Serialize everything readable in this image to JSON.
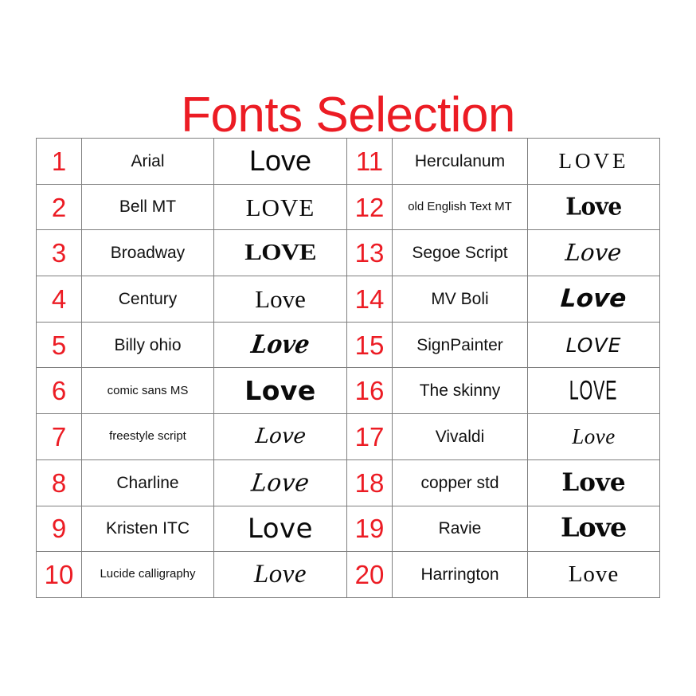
{
  "title": "Fonts Selection",
  "colors": {
    "title_red": "#ec1c24",
    "number_red": "#ec1c24",
    "border_gray": "#7f7f7f",
    "sample_black": "#0a0a0a",
    "background": "#ffffff"
  },
  "table": {
    "left_column": [
      {
        "number": "1",
        "font_name": "Arial",
        "sample": "Love",
        "name_size": "normal"
      },
      {
        "number": "2",
        "font_name": "Bell MT",
        "sample": "LOVE",
        "name_size": "normal"
      },
      {
        "number": "3",
        "font_name": "Broadway",
        "sample": "LOVE",
        "name_size": "normal"
      },
      {
        "number": "4",
        "font_name": "Century",
        "sample": "Love",
        "name_size": "normal"
      },
      {
        "number": "5",
        "font_name": "Billy ohio",
        "sample": "Love",
        "name_size": "normal"
      },
      {
        "number": "6",
        "font_name": "comic sans MS",
        "sample": "Love",
        "name_size": "small"
      },
      {
        "number": "7",
        "font_name": "freestyle script",
        "sample": "Love",
        "name_size": "small"
      },
      {
        "number": "8",
        "font_name": "Charline",
        "sample": "Love",
        "name_size": "normal"
      },
      {
        "number": "9",
        "font_name": "Kristen ITC",
        "sample": "Love",
        "name_size": "normal"
      },
      {
        "number": "10",
        "font_name": "Lucide calligraphy",
        "sample": "Love",
        "name_size": "small"
      }
    ],
    "right_column": [
      {
        "number": "11",
        "font_name": "Herculanum",
        "sample": "LOVE",
        "name_size": "normal"
      },
      {
        "number": "12",
        "font_name": "old English Text MT",
        "sample": "Love",
        "name_size": "small"
      },
      {
        "number": "13",
        "font_name": "Segoe Script",
        "sample": "Love",
        "name_size": "normal"
      },
      {
        "number": "14",
        "font_name": "MV Boli",
        "sample": "Love",
        "name_size": "normal"
      },
      {
        "number": "15",
        "font_name": "SignPainter",
        "sample": "LOVE",
        "name_size": "normal"
      },
      {
        "number": "16",
        "font_name": "The skinny",
        "sample": "LOVE",
        "name_size": "normal"
      },
      {
        "number": "17",
        "font_name": "Vivaldi",
        "sample": "Love",
        "name_size": "normal"
      },
      {
        "number": "18",
        "font_name": "copper std",
        "sample": "Love",
        "name_size": "normal"
      },
      {
        "number": "19",
        "font_name": "Ravie",
        "sample": "Love",
        "name_size": "normal"
      },
      {
        "number": "20",
        "font_name": "Harrington",
        "sample": "Love",
        "name_size": "normal"
      }
    ]
  }
}
